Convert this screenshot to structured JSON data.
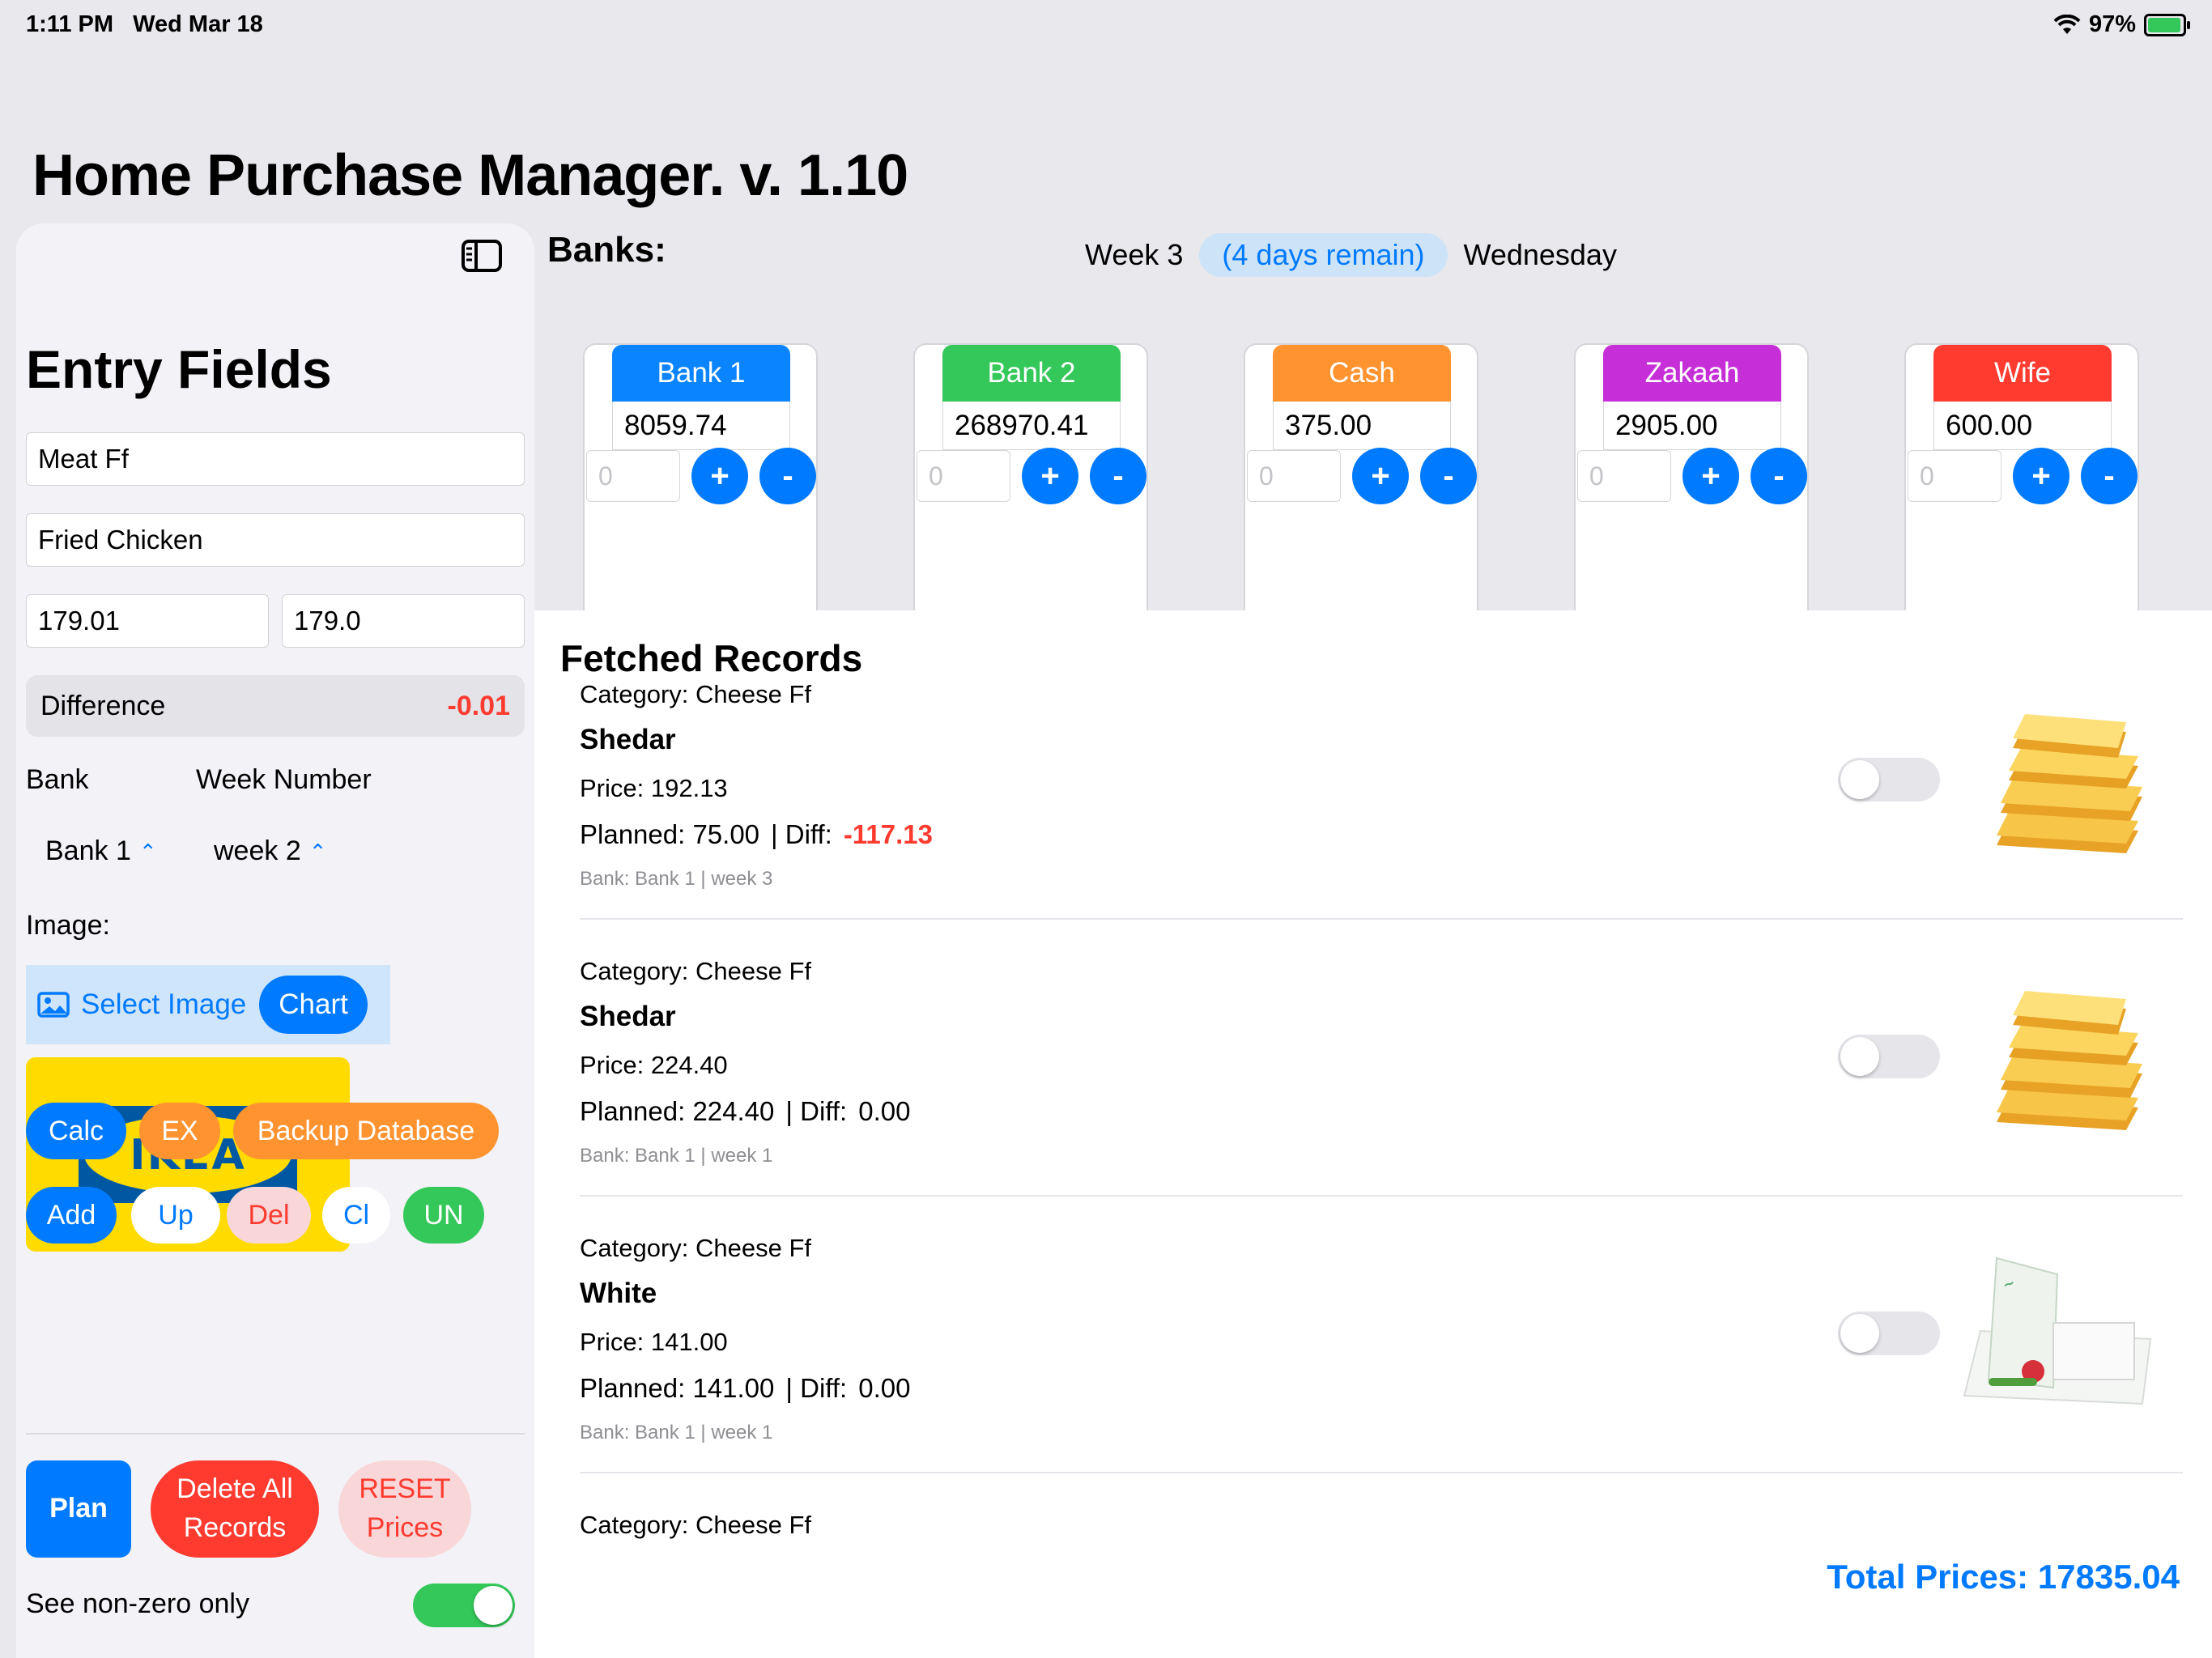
{
  "status_bar": {
    "time": "1:11 PM",
    "date": "Wed Mar 18",
    "battery": "97%"
  },
  "app_title": "Home Purchase Manager. v. 1.10",
  "sidebar": {
    "title": "Entry Fields",
    "category_value": "Meat Ff",
    "item_value": "Fried Chicken",
    "price_value": "179.01",
    "planned_value": "179.0",
    "difference_label": "Difference",
    "difference_value": "-0.01",
    "bank_label": "Bank",
    "week_label": "Week Number",
    "bank_picker": "Bank 1",
    "week_picker": "week 2",
    "image_label": "Image:",
    "select_image": "Select Image",
    "chart": "Chart",
    "ikea_logo_text": "IKEA",
    "buttons": {
      "calc": "Calc",
      "ex": "EX",
      "backup": "Backup Database",
      "add": "Add",
      "up": "Up",
      "del": "Del",
      "cl": "Cl",
      "un": "UN",
      "plan": "Plan",
      "delete_all_1": "Delete All",
      "delete_all_2": "Records",
      "reset_1": "RESET",
      "reset_2": "Prices"
    },
    "non_zero_label": "See non-zero only",
    "non_zero_on": true
  },
  "banks_header": {
    "label": "Banks:",
    "week": "Week 3",
    "days_remain": "(4 days remain)",
    "day": "Wednesday"
  },
  "banks": [
    {
      "name": "Bank 1",
      "balance": "8059.74",
      "input_placeholder": "0",
      "color": "#0a84ff"
    },
    {
      "name": "Bank 2",
      "balance": "268970.41",
      "input_placeholder": "0",
      "color": "#34c759"
    },
    {
      "name": "Cash",
      "balance": "375.00",
      "input_placeholder": "0",
      "color": "#ff9330"
    },
    {
      "name": "Zakaah",
      "balance": "2905.00",
      "input_placeholder": "0",
      "color": "#c62fd8"
    },
    {
      "name": "Wife",
      "balance": "600.00",
      "input_placeholder": "0",
      "color": "#ff3b30"
    }
  ],
  "bank_plus": "+",
  "bank_minus": "-",
  "records_title": "Fetched Records",
  "records": [
    {
      "category": "Category: Cheese Ff",
      "name": "Shedar",
      "price": "Price: 192.13",
      "planned": "Planned: 75.00",
      "diff_label": "| Diff:",
      "diff": "-117.13",
      "bank": "Bank: Bank 1 | week 3"
    },
    {
      "category": "Category: Cheese Ff",
      "name": "Shedar",
      "price": "Price: 224.40",
      "planned": "Planned: 224.40",
      "diff_label": "| Diff:",
      "diff": "0.00",
      "bank": "Bank: Bank 1 | week 1"
    },
    {
      "category": "Category: Cheese Ff",
      "name": "White",
      "price": "Price: 141.00",
      "planned": "Planned: 141.00",
      "diff_label": "| Diff:",
      "diff": "0.00",
      "bank": "Bank: Bank 1 | week 1"
    },
    {
      "category": "Category: Cheese Ff"
    }
  ],
  "total": "Total Prices: 17835.04"
}
